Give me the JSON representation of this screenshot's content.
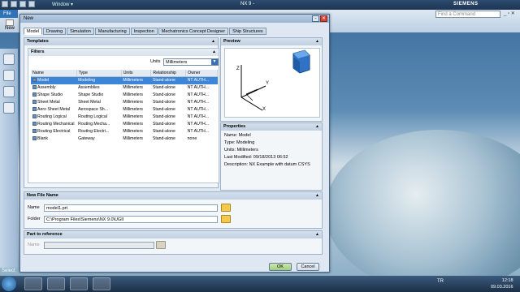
{
  "app": {
    "title": "NX 9 -",
    "brand": "SIEMENS",
    "window_menu": "Window ▾",
    "file_tab": "File",
    "new_button": "New",
    "find_command_placeholder": "Find a Command",
    "status_select": "Select"
  },
  "dialog": {
    "title": "New",
    "tabs": [
      "Model",
      "Drawing",
      "Simulation",
      "Manufacturing",
      "Inspection",
      "Mechatronics Concept Designer",
      "Ship Structures"
    ],
    "active_tab": "Model",
    "templates": {
      "header": "Templates",
      "filters_header": "Filters",
      "units_label": "Units",
      "units_value": "Millimeters",
      "columns": [
        "Name",
        "Type",
        "Units",
        "Relationship",
        "Owner"
      ],
      "rows": [
        {
          "name": "Model",
          "type": "Modeling",
          "units": "Millimeters",
          "rel": "Stand-alone",
          "owner": "NT AUTH...",
          "selected": true
        },
        {
          "name": "Assembly",
          "type": "Assemblies",
          "units": "Millimeters",
          "rel": "Stand-alone",
          "owner": "NT AUTH..."
        },
        {
          "name": "Shape Studio",
          "type": "Shape Studio",
          "units": "Millimeters",
          "rel": "Stand-alone",
          "owner": "NT AUTH..."
        },
        {
          "name": "Sheet Metal",
          "type": "Sheet Metal",
          "units": "Millimeters",
          "rel": "Stand-alone",
          "owner": "NT AUTH..."
        },
        {
          "name": "Aero Sheet Metal",
          "type": "Aerospace Sh...",
          "units": "Millimeters",
          "rel": "Stand-alone",
          "owner": "NT AUTH..."
        },
        {
          "name": "Routing Logical",
          "type": "Routing Logical",
          "units": "Millimeters",
          "rel": "Stand-alone",
          "owner": "NT AUTH..."
        },
        {
          "name": "Routing Mechanical",
          "type": "Routing Mecha...",
          "units": "Millimeters",
          "rel": "Stand-alone",
          "owner": "NT AUTH..."
        },
        {
          "name": "Routing Electrical",
          "type": "Routing Electri...",
          "units": "Millimeters",
          "rel": "Stand-alone",
          "owner": "NT AUTH..."
        },
        {
          "name": "Blank",
          "type": "Gateway",
          "units": "Millimeters",
          "rel": "Stand-alone",
          "owner": "none"
        }
      ]
    },
    "preview": {
      "header": "Preview",
      "axes": [
        "Z",
        "Y",
        "X"
      ]
    },
    "properties": {
      "header": "Properties",
      "lines": [
        "Name: Model",
        "Type: Modeling",
        "Units: Millimeters",
        "Last Modified: 09/18/2013 06:52",
        "Description: NX Example with datum CSYS"
      ]
    },
    "new_file_name": {
      "header": "New File Name",
      "name_label": "Name",
      "name_value": "model1.prt",
      "folder_label": "Folder",
      "folder_value": "C:\\Program Files\\Siemens\\NX 9.0\\UGII"
    },
    "part_to_reference": {
      "header": "Part to reference",
      "name_label": "Name"
    },
    "ok_label": "OK",
    "cancel_label": "Cancel"
  },
  "taskbar": {
    "language": "TR",
    "time": "12:18",
    "date": "09.03.2016"
  },
  "colors": {
    "selection": "#3d85d6",
    "ok": "#9fcd79",
    "close": "#d8412f"
  }
}
